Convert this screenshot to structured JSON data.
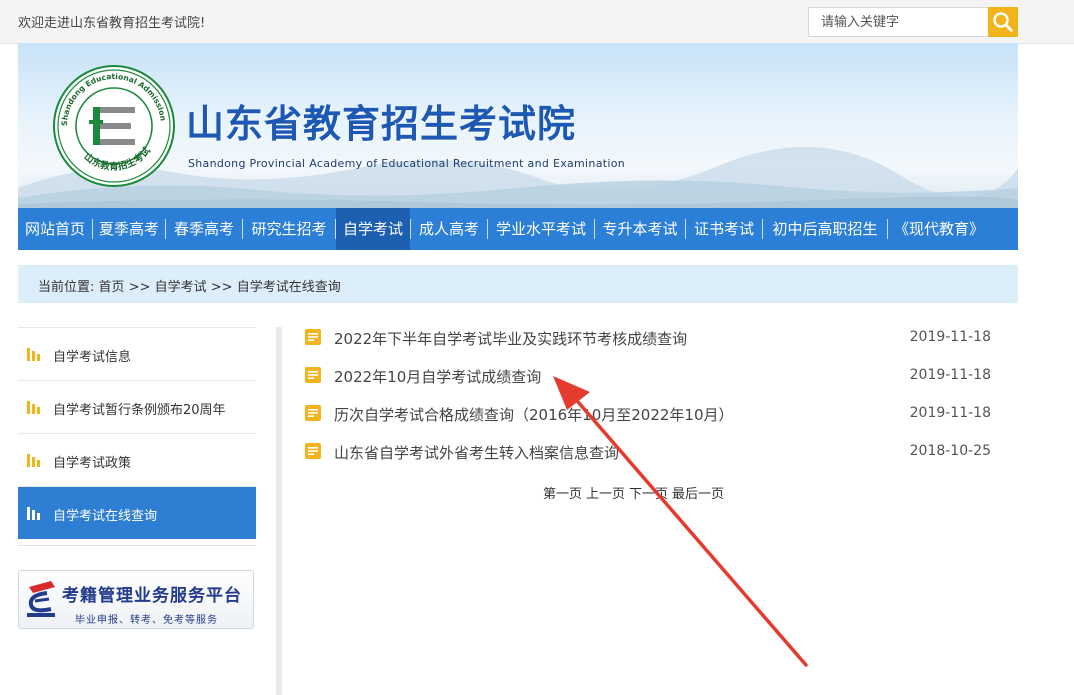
{
  "topbar": {
    "welcome": "欢迎走进山东省教育招生考试院!",
    "search_placeholder": "请输入关键字",
    "search_icon": "search-icon"
  },
  "banner": {
    "title": "山东省教育招生考试院",
    "subtitle": "Shandong Provincial Academy of Educational Recruitment and Examination",
    "logo_ring_text": "Shandong Educational Admission & Examinations",
    "logo_cn_text": "山东教育招生考试"
  },
  "nav": {
    "items": [
      {
        "label": "网站首页"
      },
      {
        "label": "夏季高考"
      },
      {
        "label": "春季高考"
      },
      {
        "label": "研究生招考"
      },
      {
        "label": "自学考试",
        "active": true
      },
      {
        "label": "成人高考"
      },
      {
        "label": "学业水平考试"
      },
      {
        "label": "专升本考试"
      },
      {
        "label": "证书考试"
      },
      {
        "label": "初中后高职招生"
      },
      {
        "label": "《现代教育》"
      }
    ]
  },
  "breadcrumb": {
    "prefix": "当前位置:",
    "items": [
      "首页",
      "自学考试",
      "自学考试在线查询"
    ],
    "separator": ">>"
  },
  "sidebar": {
    "items": [
      {
        "label": "自学考试信息"
      },
      {
        "label": "自学考试暂行条例颁布20周年"
      },
      {
        "label": "自学考试政策"
      },
      {
        "label": "自学考试在线查询",
        "active": true
      }
    ],
    "promo_title": "考籍管理业务服务平台",
    "promo_subtitle": "毕业申报、转考、免考等服务"
  },
  "list": {
    "items": [
      {
        "title": "2022年下半年自学考试毕业及实践环节考核成绩查询",
        "date": "2019-11-18"
      },
      {
        "title": "2022年10月自学考试成绩查询",
        "date": "2019-11-18"
      },
      {
        "title": "历次自学考试合格成绩查询（2016年10月至2022年10月）",
        "date": "2019-11-18"
      },
      {
        "title": "山东省自学考试外省考生转入档案信息查询",
        "date": "2018-10-25"
      }
    ]
  },
  "pager": {
    "first": "第一页",
    "prev": "上一页",
    "next": "下一页",
    "last": "最后一页"
  },
  "colors": {
    "nav_bg": "#2b7fd6",
    "nav_active": "#1d5fb0",
    "brand_blue": "#1d59b4",
    "search_btn": "#f3b41b",
    "doc_icon": "#f3b41b",
    "annotation_arrow": "#e53a2e"
  }
}
